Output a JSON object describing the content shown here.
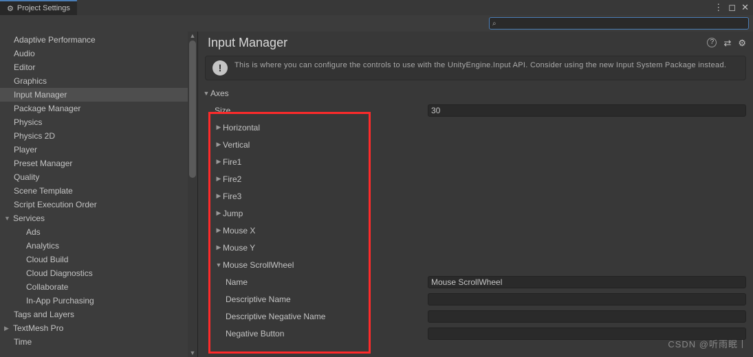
{
  "window": {
    "title": "Project Settings",
    "controls": {
      "menu": "⋮",
      "max": "◻",
      "close": "✕"
    }
  },
  "search": {
    "placeholder": ""
  },
  "sidebar": {
    "items": [
      {
        "label": "Adaptive Performance",
        "indent": 0
      },
      {
        "label": "Audio",
        "indent": 0
      },
      {
        "label": "Editor",
        "indent": 0
      },
      {
        "label": "Graphics",
        "indent": 0
      },
      {
        "label": "Input Manager",
        "indent": 0,
        "selected": true
      },
      {
        "label": "Package Manager",
        "indent": 0
      },
      {
        "label": "Physics",
        "indent": 0
      },
      {
        "label": "Physics 2D",
        "indent": 0
      },
      {
        "label": "Player",
        "indent": 0
      },
      {
        "label": "Preset Manager",
        "indent": 0
      },
      {
        "label": "Quality",
        "indent": 0
      },
      {
        "label": "Scene Template",
        "indent": 0
      },
      {
        "label": "Script Execution Order",
        "indent": 0
      },
      {
        "label": "Services",
        "indent": 0,
        "arrow": "▼"
      },
      {
        "label": "Ads",
        "indent": 1
      },
      {
        "label": "Analytics",
        "indent": 1
      },
      {
        "label": "Cloud Build",
        "indent": 1
      },
      {
        "label": "Cloud Diagnostics",
        "indent": 1
      },
      {
        "label": "Collaborate",
        "indent": 1
      },
      {
        "label": "In-App Purchasing",
        "indent": 1
      },
      {
        "label": "Tags and Layers",
        "indent": 0
      },
      {
        "label": "TextMesh Pro",
        "indent": 0,
        "arrow": "▶"
      },
      {
        "label": "Time",
        "indent": 0
      }
    ]
  },
  "main": {
    "title": "Input Manager",
    "header_icons": {
      "help": "?",
      "preset": "⇄",
      "settings": "⚙"
    },
    "info": "This is where you can configure the controls to use with the UnityEngine.Input API. Consider using the new Input System Package instead."
  },
  "axes": {
    "label": "Axes",
    "size_label": "Size",
    "size_value": "30",
    "items": [
      {
        "label": "Horizontal",
        "expanded": false
      },
      {
        "label": "Vertical",
        "expanded": false
      },
      {
        "label": "Fire1",
        "expanded": false
      },
      {
        "label": "Fire2",
        "expanded": false
      },
      {
        "label": "Fire3",
        "expanded": false
      },
      {
        "label": "Jump",
        "expanded": false
      },
      {
        "label": "Mouse X",
        "expanded": false
      },
      {
        "label": "Mouse Y",
        "expanded": false
      },
      {
        "label": "Mouse ScrollWheel",
        "expanded": true
      }
    ],
    "scrollwheel": {
      "name_label": "Name",
      "name_value": "Mouse ScrollWheel",
      "desc_label": "Descriptive Name",
      "desc_value": "",
      "descneg_label": "Descriptive Negative Name",
      "descneg_value": "",
      "negbtn_label": "Negative Button",
      "negbtn_value": ""
    }
  },
  "watermark": "CSDN @听雨眠丨"
}
